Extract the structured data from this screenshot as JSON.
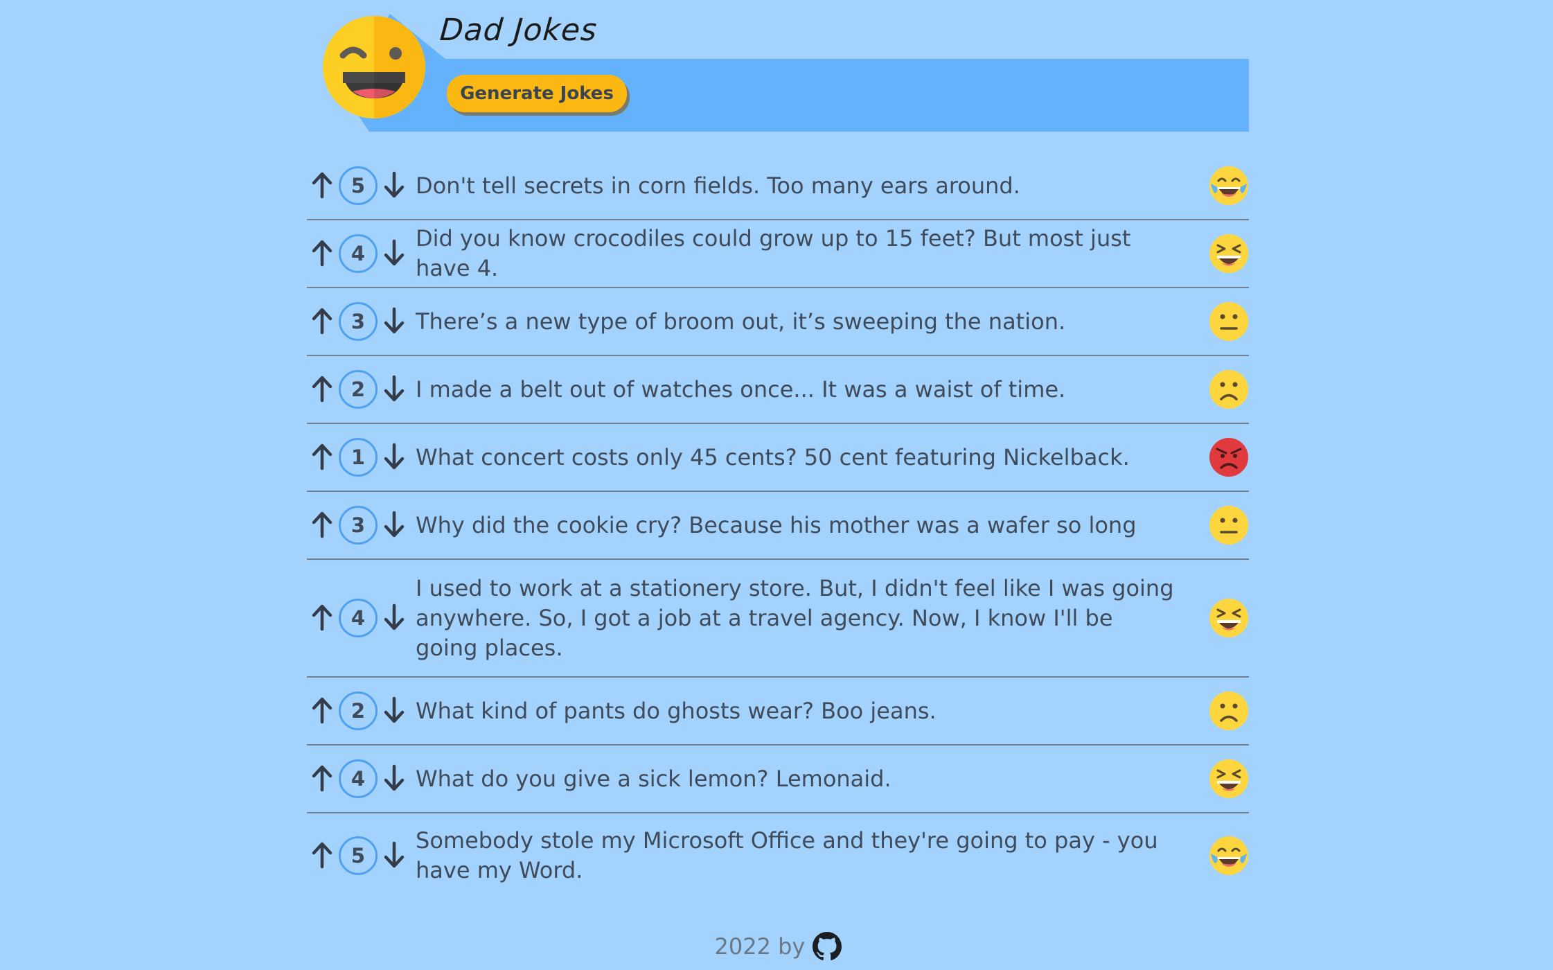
{
  "header": {
    "title": "Dad Jokes",
    "generate_label": "Generate Jokes"
  },
  "jokes": [
    {
      "score": "5",
      "text": "Don't tell secrets in corn fields. Too many ears around.",
      "emoji": "tears-of-joy-face-icon"
    },
    {
      "score": "4",
      "text": "Did you know crocodiles could grow up to 15 feet? But most just have 4.",
      "emoji": "grinning-squinting-face-icon"
    },
    {
      "score": "3",
      "text": "There’s a new type of broom out, it’s sweeping the nation.",
      "emoji": "neutral-face-icon"
    },
    {
      "score": "2",
      "text": "I made a belt out of watches once... It was a waist of time.",
      "emoji": "frowning-face-icon"
    },
    {
      "score": "1",
      "text": "What concert costs only 45 cents? 50 cent featuring Nickelback.",
      "emoji": "angry-face-icon"
    },
    {
      "score": "3",
      "text": "Why did the cookie cry? Because his mother was a wafer so long",
      "emoji": "neutral-face-icon"
    },
    {
      "score": "4",
      "text": "I used to work at a stationery store. But, I didn't feel like I was going anywhere. So, I got a job at a travel agency. Now, I know I'll be going places.",
      "emoji": "grinning-squinting-face-icon"
    },
    {
      "score": "2",
      "text": "What kind of pants do ghosts wear? Boo jeans.",
      "emoji": "frowning-face-icon"
    },
    {
      "score": "4",
      "text": "What do you give a sick lemon? Lemonaid.",
      "emoji": "grinning-squinting-face-icon"
    },
    {
      "score": "5",
      "text": "Somebody stole my Microsoft Office and they're going to pay - you have my Word.",
      "emoji": "tears-of-joy-face-icon"
    }
  ],
  "footer": {
    "text": "2022 by",
    "icon": "github-icon"
  },
  "colors": {
    "background": "#a3d3fc",
    "header_band": "#63b2fb",
    "button": "#fbb813",
    "score_ring": "#4ea0f2",
    "angry": "#e0393e",
    "emoji_yellow": "#fcd53f"
  }
}
